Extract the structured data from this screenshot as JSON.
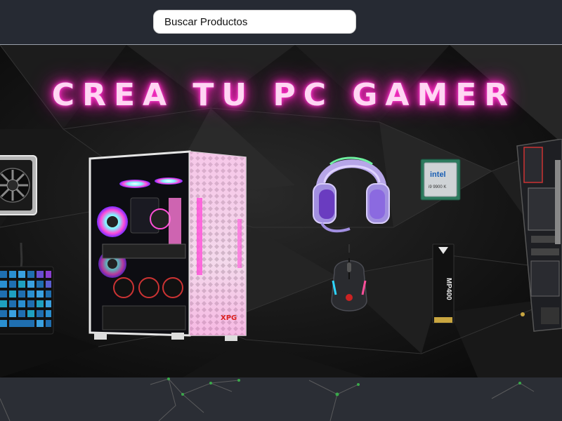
{
  "search": {
    "placeholder": "Buscar Productos"
  },
  "hero": {
    "title": "CREA TU PC GAMER",
    "title_color": "#ff2ac6"
  },
  "products": [
    {
      "icon": "graphics-card-icon"
    },
    {
      "icon": "mechanical-keyboard-icon"
    },
    {
      "icon": "pc-case-icon",
      "case_brand": "XPG"
    },
    {
      "icon": "gaming-headset-icon"
    },
    {
      "icon": "gaming-mouse-icon"
    },
    {
      "icon": "processor-icon",
      "cpu_brand": "intel",
      "cpu_model": "i9 9900 K"
    },
    {
      "icon": "ssd-icon",
      "ssd_model": "MP400"
    },
    {
      "icon": "motherboard-icon"
    }
  ]
}
